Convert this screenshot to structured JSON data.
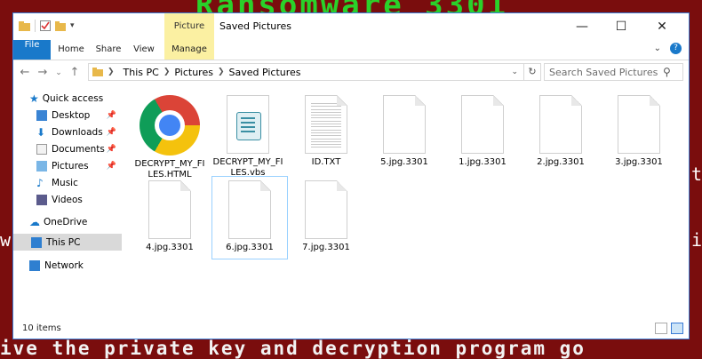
{
  "background": {
    "top_text": "Ransomware 3301",
    "bottom_text": "ive the private key and decryption program go",
    "left_fragment": "w",
    "right_fragment_1": "t",
    "right_fragment_2": "i"
  },
  "window": {
    "title": "Saved Pictures",
    "context_tab": "Picture Tools",
    "controls": {
      "minimize": "—",
      "maximize": "☐",
      "close": "✕"
    }
  },
  "ribbon": {
    "tabs": [
      {
        "label": "File"
      },
      {
        "label": "Home"
      },
      {
        "label": "Share"
      },
      {
        "label": "View"
      },
      {
        "label": "Manage"
      }
    ],
    "help": "?"
  },
  "address": {
    "crumbs": [
      "This PC",
      "Pictures",
      "Saved Pictures"
    ],
    "search_placeholder": "Search Saved Pictures"
  },
  "nav": {
    "items": [
      {
        "label": "Quick access"
      },
      {
        "label": "Desktop"
      },
      {
        "label": "Downloads"
      },
      {
        "label": "Documents"
      },
      {
        "label": "Pictures"
      },
      {
        "label": "Music"
      },
      {
        "label": "Videos"
      },
      {
        "label": "OneDrive"
      },
      {
        "label": "This PC"
      },
      {
        "label": "Network"
      }
    ]
  },
  "files": [
    {
      "name": "DECRYPT_MY_FILES.HTML",
      "icon": "chrome-html"
    },
    {
      "name": "DECRYPT_MY_FILES.vbs",
      "icon": "vbs-script"
    },
    {
      "name": "ID.TXT",
      "icon": "text-file"
    },
    {
      "name": "5.jpg.3301",
      "icon": "blank-file"
    },
    {
      "name": "1.jpg.3301",
      "icon": "blank-file"
    },
    {
      "name": "2.jpg.3301",
      "icon": "blank-file"
    },
    {
      "name": "3.jpg.3301",
      "icon": "blank-file"
    },
    {
      "name": "4.jpg.3301",
      "icon": "blank-file"
    },
    {
      "name": "6.jpg.3301",
      "icon": "blank-file"
    },
    {
      "name": "7.jpg.3301",
      "icon": "blank-file"
    }
  ],
  "status": {
    "item_count": "10 items"
  },
  "colors": {
    "accent": "#1979ca",
    "context_tab": "#fbf0a2",
    "ransom_bg": "#7a0d0d",
    "ransom_green": "#2ad12a"
  }
}
